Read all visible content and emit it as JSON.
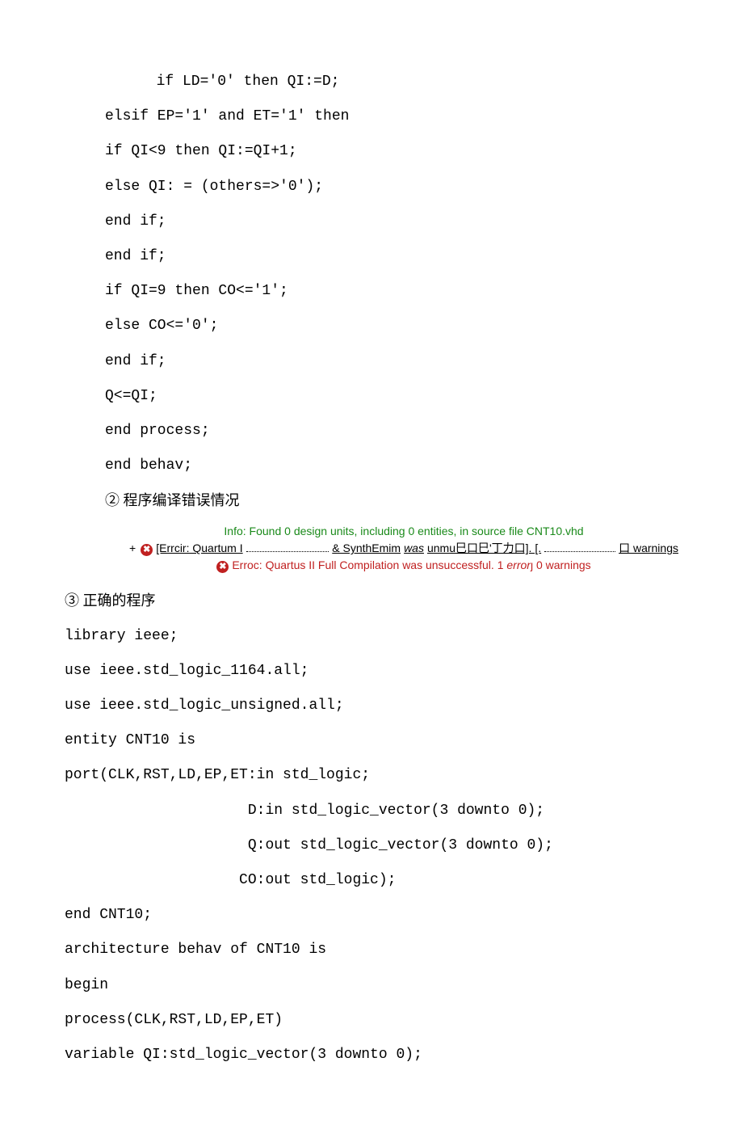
{
  "code_block1": {
    "l1": "  if LD='0' then QI:=D;",
    "l2": "elsif EP='1' and ET='1' then",
    "l3": "if QI<9 then QI:=QI+1;",
    "l4": "else QI: = (others=>'0');",
    "l5": "end if;",
    "l6": "end if;",
    "l7": "if QI=9 then CO<='1';",
    "l8": "else CO<='0';",
    "l9": "end if;",
    "l10": "Q<=QI;",
    "l11": "end process;",
    "l12": "end behav;"
  },
  "heading2": "② 程序编译错误情况",
  "errors": {
    "info": "Info: Found 0 design units, including 0 entities, in source file CNT10.vhd",
    "row2_before": "[Errcir: Quartum I",
    "row2_mid": "& SynthEmim",
    "row2_was": "was",
    "row2_after": "unmu巳口巳'丁力口].   [.",
    "row2_end": "口 warnings",
    "row3_a": "Erroc: Quartus II Full Compilation was unsuccessful. 1 ",
    "row3_err": "error",
    "row3_sub": "ȷ",
    "row3_b": " 0 warnings"
  },
  "heading3": "③  正确的程序",
  "code_block2": {
    "l1": "library ieee;",
    "l2": "use ieee.std_logic_1164.all;",
    "l3": "use ieee.std_logic_unsigned.all;",
    "l4": "entity CNT10 is",
    "l5": "port(CLK,RST,LD,EP,ET:in std_logic;",
    "l6": "                     D:in std_logic_vector(3 downto 0);",
    "l7": "                     Q:out std_logic_vector(3 downto 0);",
    "l8": "                    CO:out std_logic);",
    "l9": "end CNT10;",
    "l10": "architecture behav of CNT10 is",
    "l11": "begin",
    "l12": "process(CLK,RST,LD,EP,ET)",
    "l13": "variable QI:std_logic_vector(3 downto 0);"
  }
}
